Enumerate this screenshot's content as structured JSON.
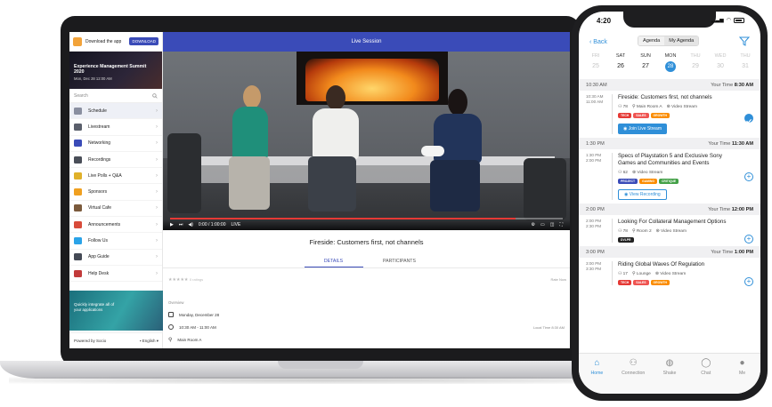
{
  "laptop": {
    "sidebar": {
      "top_text": "Download the app",
      "download_label": "DOWNLOAD",
      "event_title": "Experience Management Summit 2020",
      "event_date": "Mon, Dec 28 12:00 AM",
      "search_placeholder": "Search",
      "items": [
        {
          "label": "Schedule",
          "color": "#8a8fa0",
          "active": true
        },
        {
          "label": "Livestream",
          "color": "#5a5f6b"
        },
        {
          "label": "Networking",
          "color": "#3a4bb8"
        },
        {
          "label": "Recordings",
          "color": "#4a4e58"
        },
        {
          "label": "Live Polls + Q&A",
          "color": "#e0b12a"
        },
        {
          "label": "Sponsors",
          "color": "#f0a020"
        },
        {
          "label": "Virtual Cafe",
          "color": "#7b5a3c"
        },
        {
          "label": "Announcements",
          "color": "#d84b3a"
        },
        {
          "label": "Follow Us",
          "color": "#2aa3e8"
        },
        {
          "label": "App Guide",
          "color": "#444a55"
        },
        {
          "label": "Help Desk",
          "color": "#c23a3a"
        }
      ],
      "ad_line1": "Quickly integrate all of",
      "ad_line2": "your applications",
      "powered_by": "Powered by Socio",
      "language": "English"
    },
    "main": {
      "header": "Live Session",
      "video_time": "0:00 / 1:00:00",
      "live_label": "LIVE",
      "video_progress": 0.88,
      "session_title": "Fireside: Customers first, not channels",
      "tabs": [
        "DETAILS",
        "PARTICIPANTS"
      ],
      "rating_text": "0 ratings",
      "rating_right": "Rate Now",
      "overview_label": "Overview",
      "date": "Monday, December 28",
      "time": "10:30 AM - 11:00 AM",
      "local_time": "Local Time 8:30 AM",
      "location": "Main Room A"
    }
  },
  "phone": {
    "status_time": "4:20",
    "nav": {
      "back": "Back",
      "segments": [
        "Agenda",
        "My Agenda"
      ]
    },
    "days": [
      {
        "name": "FRI",
        "num": "25",
        "state": "dim"
      },
      {
        "name": "SAT",
        "num": "26",
        "state": ""
      },
      {
        "name": "SUN",
        "num": "27",
        "state": ""
      },
      {
        "name": "MON",
        "num": "28",
        "state": "sel"
      },
      {
        "name": "THU",
        "num": "29",
        "state": "dim"
      },
      {
        "name": "WED",
        "num": "30",
        "state": "dim"
      },
      {
        "name": "THU",
        "num": "31",
        "state": "dim"
      }
    ],
    "slots": [
      {
        "left": "10:30 AM",
        "right_label": "Your Time",
        "right_time": "8:30 AM",
        "start": "10:30 AM",
        "end": "11:00 AM",
        "title": "Fireside: Customers first, not channels",
        "count": "78",
        "room": "Main Room A",
        "stream": "Video Stream",
        "tags": [
          {
            "t": "TECH",
            "c": "#e53935"
          },
          {
            "t": "SALES",
            "c": "#ef5350"
          },
          {
            "t": "GROWTH",
            "c": "#fb8c00"
          }
        ],
        "button": "Join Live Stream",
        "button_style": "blue",
        "action": "check"
      },
      {
        "left": "1:30 PM",
        "right_label": "Your Time",
        "right_time": "11:30 AM",
        "start": "1:30 PM",
        "end": "2:00 PM",
        "title": "Specs of Playstation 5 and Exclusive Sony Games and Communities and Events",
        "count": "62",
        "room": "",
        "stream": "Video Stream",
        "tags": [
          {
            "t": "PROJECT",
            "c": "#3a4bb8"
          },
          {
            "t": "GAMING",
            "c": "#fb8c00"
          },
          {
            "t": "CRITIQUE",
            "c": "#43a047"
          }
        ],
        "button": "View Recording",
        "button_style": "outline",
        "action": "add"
      },
      {
        "left": "2:00 PM",
        "right_label": "Your Time",
        "right_time": "12:00 PM",
        "start": "2:00 PM",
        "end": "2:30 PM",
        "title": "Looking For Collateral Management Options",
        "count": "78",
        "room": "Room 2",
        "stream": "Video Stream",
        "tags": [
          {
            "t": "DVLPR",
            "c": "#222222"
          }
        ],
        "button": "",
        "button_style": "",
        "action": "add"
      },
      {
        "left": "3:00 PM",
        "right_label": "Your Time",
        "right_time": "1:00 PM",
        "start": "3:00 PM",
        "end": "3:30 PM",
        "title": "Riding Global Waves Of Regulation",
        "count": "17",
        "room": "Lounge",
        "stream": "Video Stream",
        "tags": [
          {
            "t": "TECH",
            "c": "#e53935"
          },
          {
            "t": "SALES",
            "c": "#ef5350"
          },
          {
            "t": "GROWTH",
            "c": "#fb8c00"
          }
        ],
        "button": "",
        "button_style": "",
        "action": "add"
      }
    ],
    "tabbar": [
      "Home",
      "Connection",
      "Shake",
      "Chat",
      "Me"
    ]
  }
}
